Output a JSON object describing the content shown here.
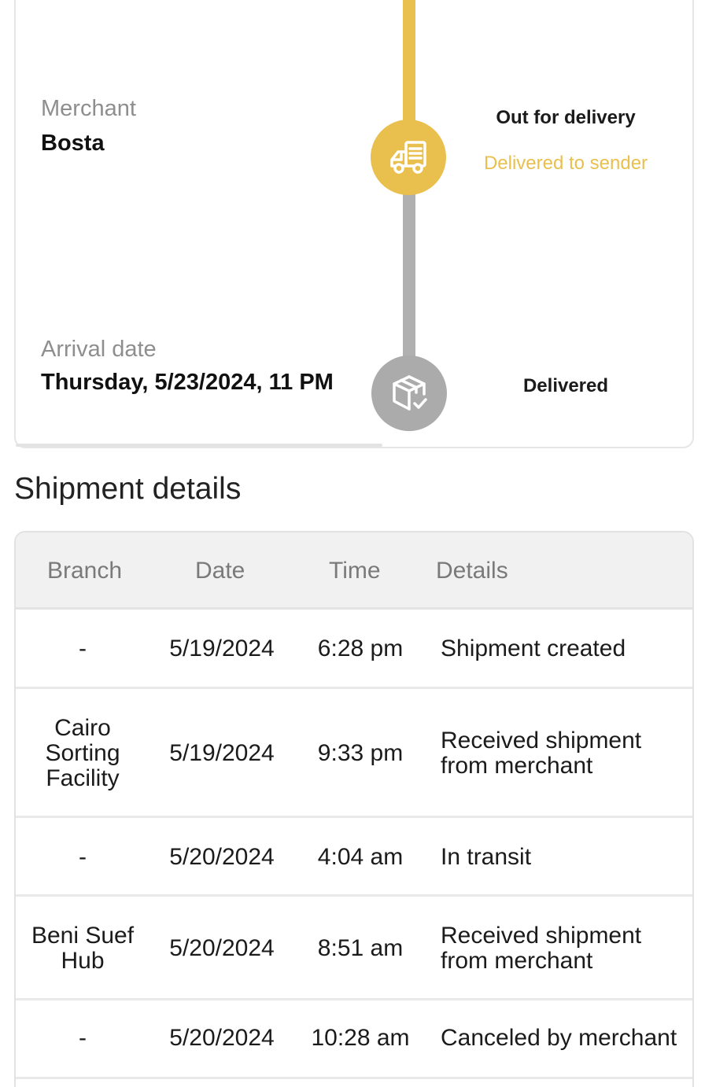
{
  "tracking": {
    "merchant_label": "Merchant",
    "merchant_value": "Bosta",
    "arrival_label": "Arrival date",
    "arrival_value": "Thursday, 5/23/2024, 11 PM",
    "steps": [
      {
        "title": "Out for delivery",
        "subtitle": "Delivered to sender",
        "icon": "delivery-truck-icon",
        "state": "active"
      },
      {
        "title": "Delivered",
        "subtitle": "",
        "icon": "package-check-icon",
        "state": "pending"
      }
    ]
  },
  "details": {
    "title": "Shipment details",
    "headers": {
      "branch": "Branch",
      "date": "Date",
      "time": "Time",
      "details": "Details"
    },
    "rows": [
      {
        "branch": "-",
        "date": "5/19/2024",
        "time": "6:28 pm",
        "details": "Shipment created"
      },
      {
        "branch": "Cairo Sorting Facility",
        "date": "5/19/2024",
        "time": "9:33 pm",
        "details": "Received shipment from merchant"
      },
      {
        "branch": "-",
        "date": "5/20/2024",
        "time": "4:04 am",
        "details": "In transit"
      },
      {
        "branch": "Beni Suef Hub",
        "date": "5/20/2024",
        "time": "8:51 am",
        "details": "Received shipment from merchant"
      },
      {
        "branch": "-",
        "date": "5/20/2024",
        "time": "10:28 am",
        "details": "Canceled by merchant"
      }
    ]
  },
  "colors": {
    "accent": "#e9bf4d",
    "pending": "#ababab",
    "header_bg": "#f1f1f1"
  }
}
